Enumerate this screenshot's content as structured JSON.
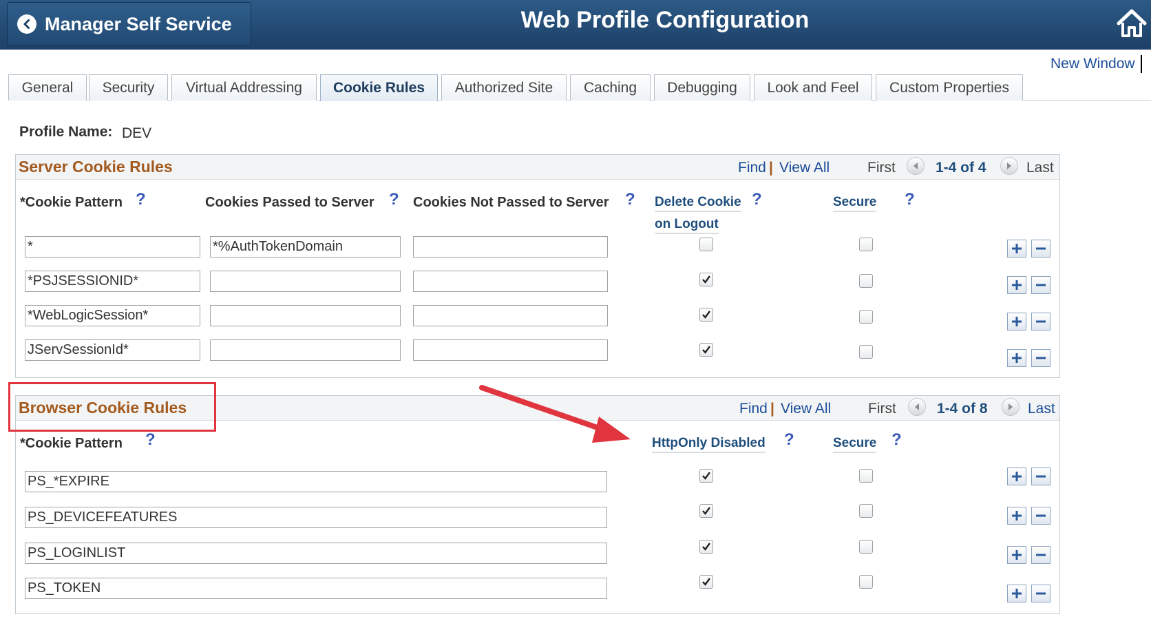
{
  "header": {
    "back_label": "Manager Self Service",
    "title": "Web Profile Configuration"
  },
  "new_window": "New Window",
  "tabs": [
    {
      "label": "General"
    },
    {
      "label": "Security"
    },
    {
      "label": "Virtual Addressing"
    },
    {
      "label": "Cookie Rules",
      "active": true
    },
    {
      "label": "Authorized Site"
    },
    {
      "label": "Caching"
    },
    {
      "label": "Debugging"
    },
    {
      "label": "Look and Feel"
    },
    {
      "label": "Custom Properties"
    }
  ],
  "profile": {
    "label": "Profile Name:",
    "value": "DEV"
  },
  "server_rules": {
    "title": "Server Cookie Rules",
    "nav": {
      "find": "Find",
      "sep": "|",
      "view_all": "View All",
      "first": "First",
      "count": "1-4 of 4",
      "last": "Last"
    },
    "columns": {
      "pattern": "*Cookie Pattern",
      "passed": "Cookies Passed to Server",
      "not_passed": "Cookies Not Passed to Server",
      "delete_line1": "Delete Cookie",
      "delete_line2": "on Logout",
      "secure": "Secure",
      "help": "?"
    },
    "rows": [
      {
        "pattern": "*",
        "passed": "*%AuthTokenDomain",
        "not_passed": "",
        "delete_on_logout": false,
        "secure": false
      },
      {
        "pattern": "*PSJSESSIONID*",
        "passed": "",
        "not_passed": "",
        "delete_on_logout": true,
        "secure": false
      },
      {
        "pattern": "*WebLogicSession*",
        "passed": "",
        "not_passed": "",
        "delete_on_logout": true,
        "secure": false
      },
      {
        "pattern": "JServSessionId*",
        "passed": "",
        "not_passed": "",
        "delete_on_logout": true,
        "secure": false
      }
    ]
  },
  "browser_rules": {
    "title": "Browser Cookie Rules",
    "nav": {
      "find": "Find",
      "sep": "|",
      "view_all": "View All",
      "first": "First",
      "count": "1-4 of 8",
      "last": "Last"
    },
    "columns": {
      "pattern": "*Cookie Pattern",
      "httponly": "HttpOnly Disabled",
      "secure": "Secure",
      "help": "?"
    },
    "rows": [
      {
        "pattern": "PS_*EXPIRE",
        "httponly_disabled": true,
        "secure": false
      },
      {
        "pattern": "PS_DEVICEFEATURES",
        "httponly_disabled": true,
        "secure": false
      },
      {
        "pattern": "PS_LOGINLIST",
        "httponly_disabled": true,
        "secure": false
      },
      {
        "pattern": "PS_TOKEN",
        "httponly_disabled": true,
        "secure": false
      }
    ]
  },
  "colors": {
    "header": "#1d4067",
    "section_title": "#a35a1e",
    "annotation": "#e0343e",
    "link": "#1a4d9a"
  }
}
